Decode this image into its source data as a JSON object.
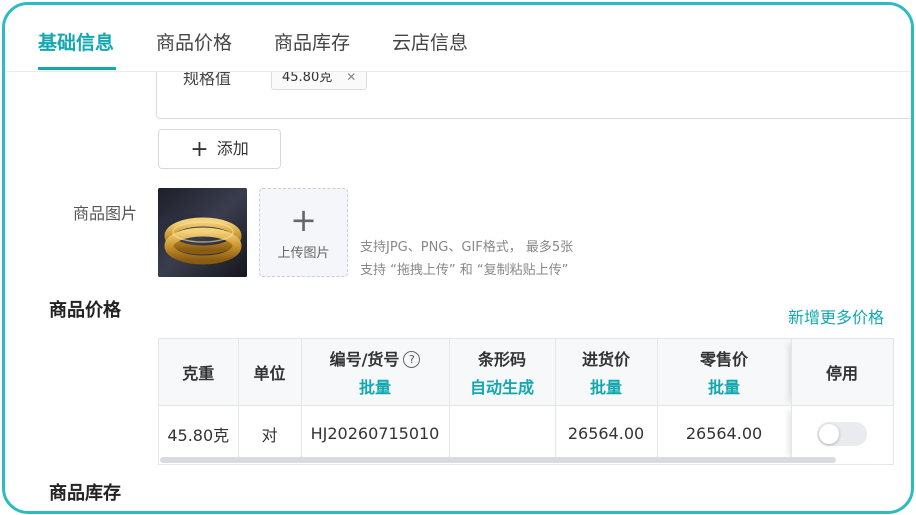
{
  "tabs": [
    {
      "label": "基础信息",
      "active": true
    },
    {
      "label": "商品价格",
      "active": false
    },
    {
      "label": "商品库存",
      "active": false
    },
    {
      "label": "云店信息",
      "active": false
    }
  ],
  "spec": {
    "label": "规格值",
    "tag": "45.80克"
  },
  "add_button": {
    "icon": "plus-icon",
    "label": "添加"
  },
  "images": {
    "label": "商品图片",
    "thumbnail_icon": "gold-bracelet-image",
    "upload_label": "上传图片",
    "hint_line1": "支持JPG、PNG、GIF格式， 最多5张",
    "hint_line2": "支持 “拖拽上传” 和 “复制粘贴上传”"
  },
  "price_section": {
    "title": "商品价格",
    "more_link": "新增更多价格",
    "columns": [
      {
        "label": "克重",
        "sub": ""
      },
      {
        "label": "单位",
        "sub": ""
      },
      {
        "label": "编号/货号",
        "sub": "批量",
        "help": "?"
      },
      {
        "label": "条形码",
        "sub": "自动生成"
      },
      {
        "label": "进货价",
        "sub": "批量"
      },
      {
        "label": "零售价",
        "sub": "批量"
      },
      {
        "label": "停用",
        "sub": ""
      }
    ],
    "rows": [
      {
        "weight": "45.80克",
        "unit": "对",
        "code": "HJ20260715010",
        "barcode": "",
        "cost": "26564.00",
        "retail": "26564.00",
        "disabled": false
      }
    ]
  },
  "stock_section": {
    "title": "商品库存"
  },
  "colors": {
    "accent": "#13a8b0",
    "frame": "#2bbcc2",
    "header_bg": "#f7f8fa"
  }
}
